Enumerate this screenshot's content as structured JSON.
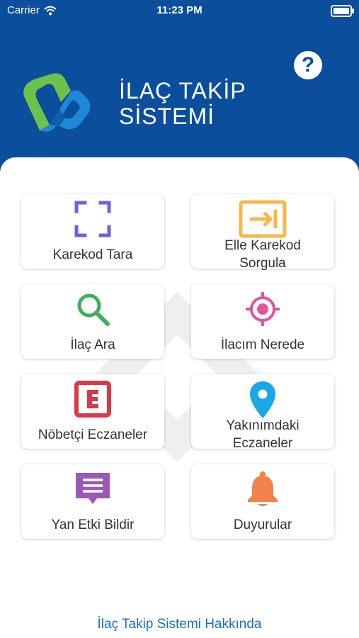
{
  "status_bar": {
    "carrier": "Carrier",
    "time": "11:23 PM",
    "battery_level": 0.85
  },
  "header": {
    "title_line1": "İLAÇ TAKİP",
    "title_line2": "SİSTEMİ",
    "help_label": "?"
  },
  "menu": {
    "items": [
      {
        "label": "Karekod Tara",
        "icon": "scan-frame-icon",
        "color": "#6c63e0"
      },
      {
        "label_line1": "Elle Karekod",
        "label_line2": "Sorgula",
        "icon": "manual-entry-icon",
        "color": "#f5b84a"
      },
      {
        "label": "İlaç Ara",
        "icon": "search-icon",
        "color": "#3fae5a"
      },
      {
        "label": "İlacım Nerede",
        "icon": "target-icon",
        "color": "#e2559b"
      },
      {
        "label": "Nöbetçi Eczaneler",
        "icon": "pharmacy-e-icon",
        "color": "#d8394b"
      },
      {
        "label_line1": "Yakınımdaki",
        "label_line2": "Eczaneler",
        "icon": "location-pin-icon",
        "color": "#1aa7e6"
      },
      {
        "label": "Yan Etki Bildir",
        "icon": "message-icon",
        "color": "#9b59b6"
      },
      {
        "label": "Duyurular",
        "icon": "bell-icon",
        "color": "#f0824a"
      }
    ]
  },
  "footer": {
    "about_link": "İlaç Takip Sistemi Hakkında"
  },
  "colors": {
    "header_bg": "#0b4f9c",
    "link": "#1a6fc4"
  }
}
